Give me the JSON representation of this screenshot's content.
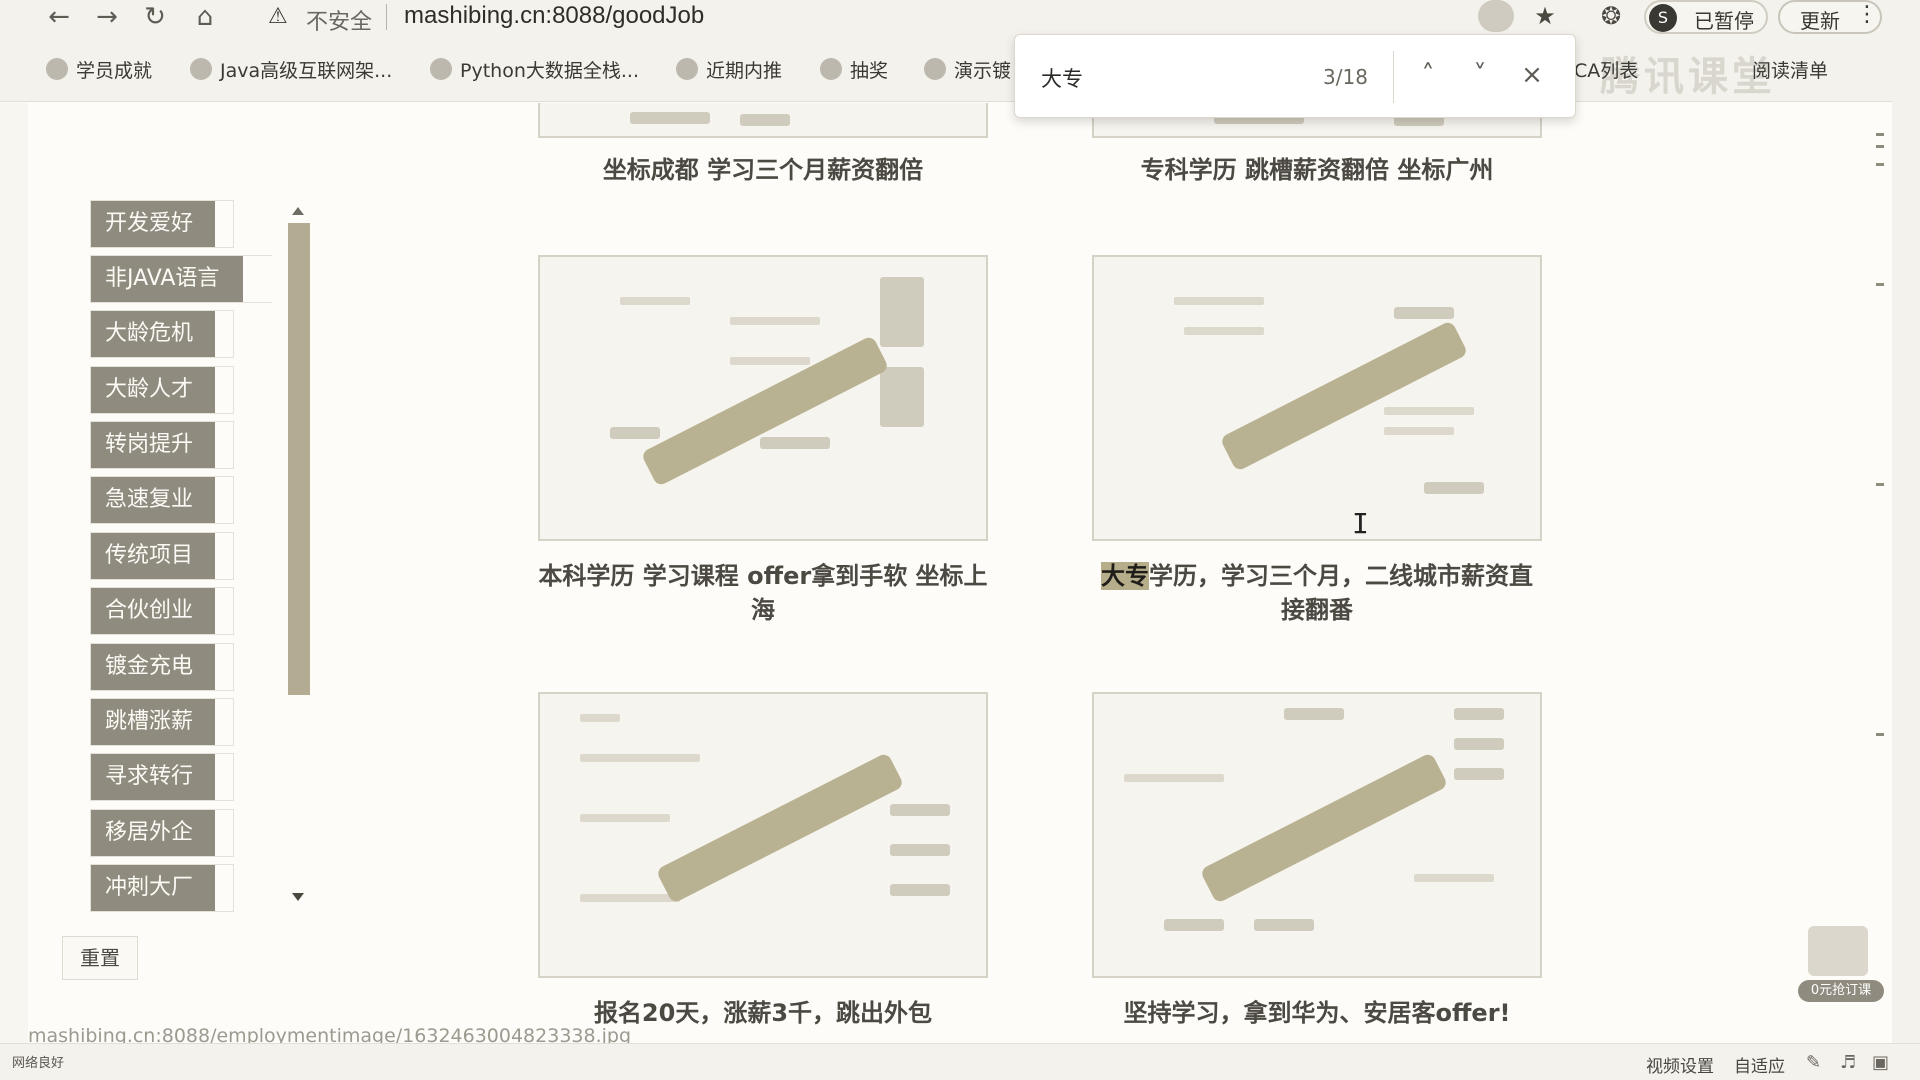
{
  "browser": {
    "warning_label": "不安全",
    "url": "mashibing.cn:8088/goodJob",
    "profile_initial": "S",
    "profile_status": "已暂停",
    "update_label": "更新",
    "bookmarks": [
      {
        "label": "学员成就"
      },
      {
        "label": "Java高级互联网架..."
      },
      {
        "label": "Python大数据全栈..."
      },
      {
        "label": "近期内推"
      },
      {
        "label": "抽奖"
      },
      {
        "label": "演示镀"
      }
    ],
    "extra_bookmark": "CA列表",
    "reading_list": "阅读清单",
    "watermark": "腾讯课堂"
  },
  "find_bar": {
    "query": "大专",
    "count": "3/18"
  },
  "sidebar": {
    "categories": [
      {
        "label": "开发爱好"
      },
      {
        "label": "非JAVA语言"
      },
      {
        "label": "大龄危机"
      },
      {
        "label": "大龄人才"
      },
      {
        "label": "转岗提升"
      },
      {
        "label": "急速复业"
      },
      {
        "label": "传统项目"
      },
      {
        "label": "合伙创业"
      },
      {
        "label": "镀金充电"
      },
      {
        "label": "跳槽涨薪"
      },
      {
        "label": "寻求转行"
      },
      {
        "label": "移居外企"
      },
      {
        "label": "冲刺大厂"
      }
    ],
    "reset_label": "重置"
  },
  "cards": [
    {
      "caption": "坐标成都 学习三个月薪资翻倍"
    },
    {
      "caption": "专科学历 跳槽薪资翻倍 坐标广州"
    },
    {
      "caption_line1": "本科学历 学习课程 offer拿到手软 坐标上",
      "caption_line2": "海"
    },
    {
      "caption_hl": "大专",
      "caption_rest": "学历，学习三个月，二线城市薪资直",
      "caption_line2": "接翻番"
    },
    {
      "caption": "报名20天，涨薪3千，跳出外包"
    },
    {
      "caption": "坚持学习，拿到华为、安居客offer!"
    }
  ],
  "status_url": "mashibing.cn:8088/employmentimage/1632463004823338.jpg",
  "promo": {
    "label": "0元抢订课"
  },
  "player_bar": {
    "network": "网络良好",
    "video_settings": "视频设置",
    "fit": "自适应"
  }
}
